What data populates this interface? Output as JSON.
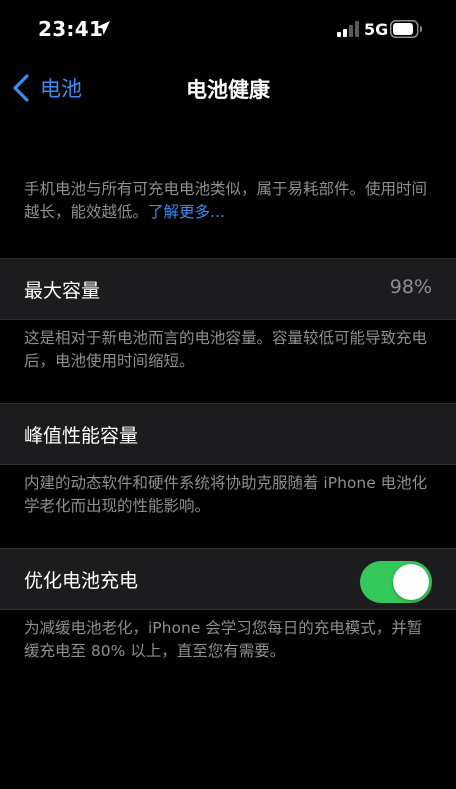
{
  "status_bar": {
    "time": "23:41",
    "network": "5G",
    "icons": [
      "location-arrow-icon",
      "cellular-signal-icon",
      "battery-icon"
    ]
  },
  "nav": {
    "back_label": "电池",
    "title": "电池健康"
  },
  "intro": {
    "text": "手机电池与所有可充电电池类似，属于易耗部件。使用时间越长，能效越低。",
    "link_label": "了解更多..."
  },
  "max_capacity": {
    "label": "最大容量",
    "value": "98%",
    "footer": "这是相对于新电池而言的电池容量。容量较低可能导致充电后，电池使用时间缩短。"
  },
  "peak_performance": {
    "label": "峰值性能容量",
    "footer": "内建的动态软件和硬件系统将协助克服随着 iPhone 电池化学老化而出现的性能影响。"
  },
  "optimized_charging": {
    "label": "优化电池充电",
    "enabled": true,
    "footer": "为减缓电池老化，iPhone 会学习您每日的充电模式，并暂缓充电至 80% 以上，直至您有需要。"
  },
  "colors": {
    "accent": "#3a8cf5",
    "toggle_on": "#34c759",
    "secondary_text": "#8e8e93",
    "cell_background": "#1c1c1e"
  }
}
